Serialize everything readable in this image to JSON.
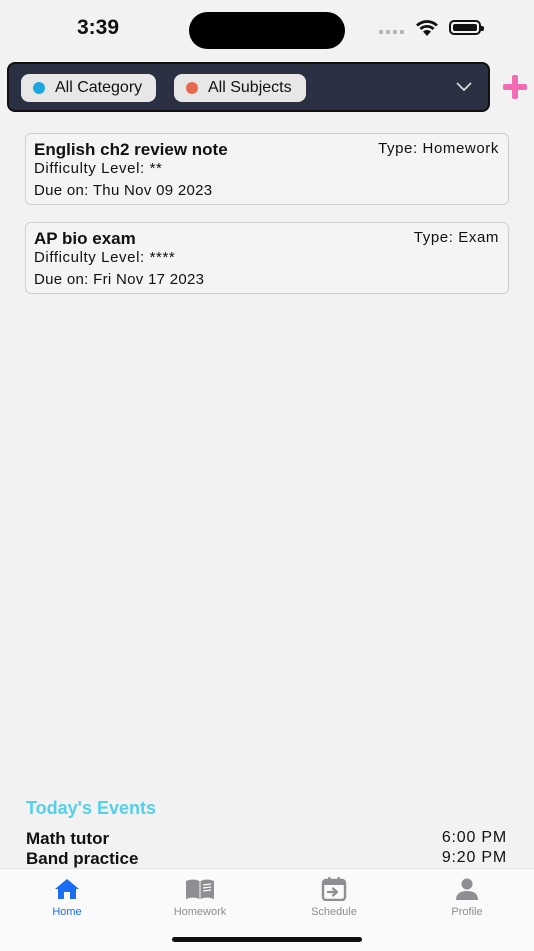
{
  "status_bar": {
    "time": "3:39"
  },
  "filters": {
    "category": {
      "label": "All Category",
      "dot_color": "#1aa7e0"
    },
    "subjects": {
      "label": "All Subjects",
      "dot_color": "#e76a4f"
    }
  },
  "assignments": [
    {
      "title": "English ch2 review note",
      "type": "Type: Homework",
      "difficulty": "Difficulty Level: **",
      "due": "Due on: Thu Nov 09 2023"
    },
    {
      "title": "AP bio exam",
      "type": "Type: Exam",
      "difficulty": "Difficulty Level: ****",
      "due": "Due on: Fri Nov 17 2023"
    }
  ],
  "events": {
    "title": "Today's Events",
    "items": [
      {
        "name": "Math tutor",
        "time": "6:00 PM"
      },
      {
        "name": "Band practice",
        "time": "9:20 PM"
      }
    ]
  },
  "tabs": [
    {
      "label": "Home",
      "icon": "home-icon",
      "active": true
    },
    {
      "label": "Homework",
      "icon": "book-icon",
      "active": false
    },
    {
      "label": "Schedule",
      "icon": "calendar-icon",
      "active": false
    },
    {
      "label": "Profile",
      "icon": "person-icon",
      "active": false
    }
  ],
  "colors": {
    "accent": "#1b6ef3",
    "add": "#f26bb3",
    "events_title": "#56cfe8",
    "filter_bar": "#2b2f42"
  }
}
